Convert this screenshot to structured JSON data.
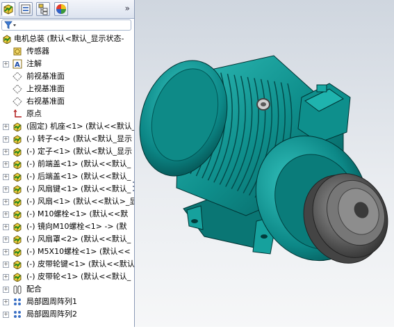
{
  "tabs": [
    {
      "name": "feature-manager",
      "active": true
    },
    {
      "name": "property-manager",
      "active": false
    },
    {
      "name": "configuration-manager",
      "active": false
    },
    {
      "name": "display-manager",
      "active": false
    }
  ],
  "tabs_more": "»",
  "tree": [
    {
      "label": "电机总装  (默认<默认_显示状态-",
      "icon": "assembly-icon",
      "indent": 0,
      "expander": false
    },
    {
      "label": "传感器",
      "icon": "sensor-icon",
      "indent": 1,
      "expander": false
    },
    {
      "label": "注解",
      "icon": "annotation-icon",
      "indent": 1,
      "expander": true
    },
    {
      "label": "前视基准面",
      "icon": "plane-icon",
      "indent": 1,
      "expander": false
    },
    {
      "label": "上视基准面",
      "icon": "plane-icon",
      "indent": 1,
      "expander": false
    },
    {
      "label": "右视基准面",
      "icon": "plane-icon",
      "indent": 1,
      "expander": false
    },
    {
      "label": "原点",
      "icon": "origin-icon",
      "indent": 1,
      "expander": false
    },
    {
      "label": "(固定) 机座<1> (默认<<默认_",
      "icon": "part-icon",
      "indent": 1,
      "expander": true
    },
    {
      "label": "(-) 转子<4> (默认<默认_显示",
      "icon": "part-icon",
      "indent": 1,
      "expander": true
    },
    {
      "label": "(-) 定子<1> (默认<默认_显示",
      "icon": "part-icon",
      "indent": 1,
      "expander": true
    },
    {
      "label": "(-) 前端盖<1> (默认<<默认_",
      "icon": "part-icon",
      "indent": 1,
      "expander": true
    },
    {
      "label": "(-) 后端盖<1> (默认<<默认_",
      "icon": "part-icon",
      "indent": 1,
      "expander": true
    },
    {
      "label": "(-) 风扇键<1> (默认<<默认_",
      "icon": "part-icon",
      "indent": 1,
      "expander": true
    },
    {
      "label": "(-) 风扇<1> (默认<<默认>_显",
      "icon": "part-icon",
      "indent": 1,
      "expander": true
    },
    {
      "label": "(-) M10螺栓<1> (默认<<默",
      "icon": "part-icon",
      "indent": 1,
      "expander": true
    },
    {
      "label": "(-) 镜向M10螺栓<1> -> (默",
      "icon": "part-icon",
      "indent": 1,
      "expander": true
    },
    {
      "label": "(-) 风扇罩<2> (默认<<默认_",
      "icon": "part-icon",
      "indent": 1,
      "expander": true
    },
    {
      "label": "(-) M5X10螺栓<1> (默认<<",
      "icon": "part-icon",
      "indent": 1,
      "expander": true
    },
    {
      "label": "(-) 皮带轮键<1> (默认<<默认",
      "icon": "part-icon",
      "indent": 1,
      "expander": true
    },
    {
      "label": "(-) 皮带轮<1> (默认<<默认_",
      "icon": "part-icon",
      "indent": 1,
      "expander": true
    },
    {
      "label": "配合",
      "icon": "mates-icon",
      "indent": 1,
      "expander": true
    },
    {
      "label": "局部圆周阵列1",
      "icon": "pattern-icon",
      "indent": 1,
      "expander": true
    },
    {
      "label": "局部圆周阵列2",
      "icon": "pattern-icon",
      "indent": 1,
      "expander": true
    }
  ],
  "colors": {
    "motor": "#0e8f8f",
    "motor_dark": "#066565",
    "motor_light": "#29b7b2",
    "pulley": "#5b5b5b",
    "background": "#dfe3e8"
  }
}
